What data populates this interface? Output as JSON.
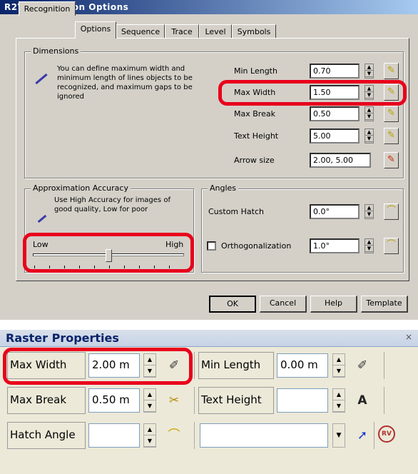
{
  "dialog": {
    "title": "R2V Conversion Options",
    "tabs": [
      "Recognition",
      "Options",
      "Sequence",
      "Trace",
      "Level",
      "Symbols"
    ],
    "dimensions": {
      "group_title": "Dimensions",
      "description": "You can define maximum width and minimum length of lines objects to be recognized, and maximum gaps to be ignored",
      "fields": [
        {
          "label": "Min Length",
          "value": "0.70"
        },
        {
          "label": "Max Width",
          "value": "1.50"
        },
        {
          "label": "Max Break",
          "value": "0.50"
        },
        {
          "label": "Text Height",
          "value": "5.00"
        },
        {
          "label": "Arrow size",
          "value": "2.00, 5.00"
        }
      ]
    },
    "approx": {
      "group_title": "Approximation Accuracy",
      "description": "Use High Accuracy for images of good quality, Low for poor",
      "low_label": "Low",
      "high_label": "High",
      "slider_position": 0.5
    },
    "angles": {
      "group_title": "Angles",
      "custom_hatch_label": "Custom Hatch",
      "custom_hatch_value": "0.0°",
      "ortho_label": "Orthogonalization",
      "ortho_value": "1.0°",
      "ortho_checked": false
    },
    "buttons": {
      "ok": "OK",
      "cancel": "Cancel",
      "help": "Help",
      "template": "Template"
    }
  },
  "toolbar": {
    "title": "Raster Properties",
    "close_label": "×",
    "max_width_label": "Max Width",
    "max_width_value": "2.00 m",
    "min_length_label": "Min Length",
    "min_length_value": "0.00 m",
    "max_break_label": "Max Break",
    "max_break_value": "0.50 m",
    "text_height_label": "Text Height",
    "text_height_value": "",
    "hatch_angle_label": "Hatch Angle",
    "hatch_angle_value": "",
    "dropdown_value": "",
    "rv_label": "RV"
  },
  "colors": {
    "highlight": "#e8001c",
    "title_blue": "#0a246a"
  }
}
